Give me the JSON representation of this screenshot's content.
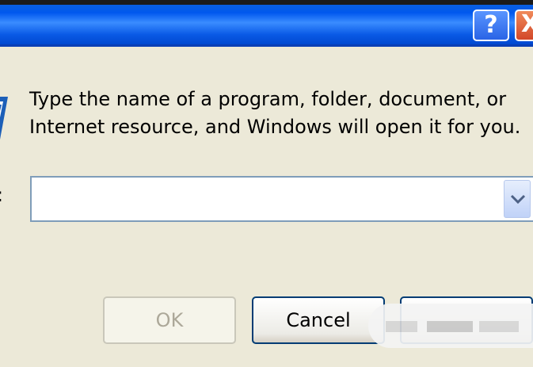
{
  "window": {
    "help_icon": "question-mark",
    "close_icon": "close-x",
    "help_glyph": "?",
    "close_glyph": "X"
  },
  "dialog": {
    "icon": "run-icon",
    "prompt_line1": "Type the name of a program, folder, document, or",
    "prompt_line2": "Internet resource, and Windows will open it for you.",
    "open_label": ":",
    "open_value": ""
  },
  "buttons": {
    "ok": "OK",
    "cancel": "Cancel",
    "browse": ""
  },
  "colors": {
    "titlebar": "#0058ee",
    "dialog_bg": "#ece9d8",
    "close": "#d2482a"
  }
}
